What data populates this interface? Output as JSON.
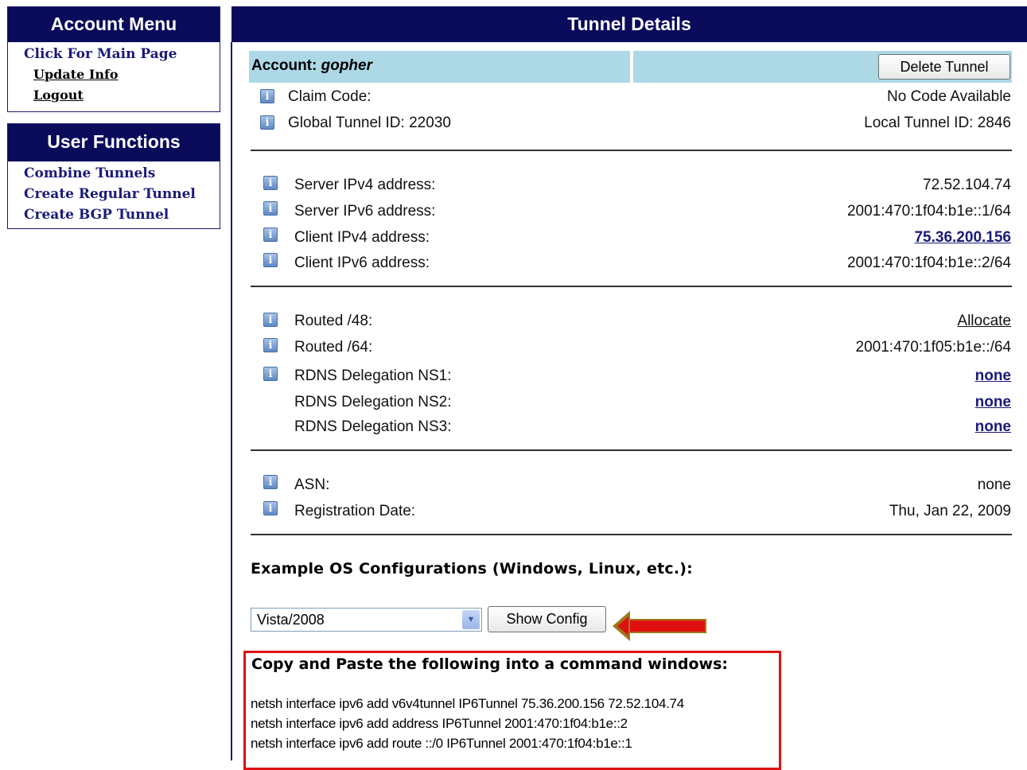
{
  "sidebar": {
    "account_menu": {
      "title": "Account Menu",
      "items": [
        "Click For Main Page",
        "Update Info",
        "Logout"
      ]
    },
    "user_functions": {
      "title": "User Functions",
      "items": [
        "Combine Tunnels",
        "Create Regular Tunnel",
        "Create BGP Tunnel"
      ]
    }
  },
  "main": {
    "title": "Tunnel Details",
    "account_label": "Account: ",
    "account_name": "gopher",
    "delete_button": "Delete Tunnel",
    "claim": {
      "label": "Claim Code:",
      "value": "No Code Available"
    },
    "ids": {
      "global": "Global Tunnel ID: 22030",
      "local": "Local Tunnel ID: 2846"
    },
    "addresses": [
      {
        "label": "Server IPv4 address:",
        "value": "72.52.104.74"
      },
      {
        "label": "Server IPv6 address:",
        "value": "2001:470:1f04:b1e::1/64"
      },
      {
        "label": "Client IPv4 address:",
        "value": "75.36.200.156"
      },
      {
        "label": "Client IPv6 address:",
        "value": "2001:470:1f04:b1e::2/64"
      }
    ],
    "routed": [
      {
        "label": "Routed /48:",
        "value": "Allocate"
      },
      {
        "label": "Routed /64:",
        "value": "2001:470:1f05:b1e::/64"
      },
      {
        "label": "RDNS Delegation NS1:",
        "value": "none"
      },
      {
        "label": "RDNS Delegation NS2:",
        "value": "none"
      },
      {
        "label": "RDNS Delegation NS3:",
        "value": "none"
      }
    ],
    "asn": {
      "label": "ASN:",
      "value": "none"
    },
    "registration": {
      "label": "Registration Date:",
      "value": "Thu, Jan 22, 2009"
    },
    "examples_heading": "Example OS Configurations (Windows, Linux, etc.):",
    "os_select": {
      "selected": "Vista/2008"
    },
    "show_config_button": "Show Config",
    "config": {
      "heading": "Copy and Paste the following into a command windows:",
      "lines": [
        "netsh interface ipv6 add v6v4tunnel IP6Tunnel 75.36.200.156 72.52.104.74",
        "netsh interface ipv6 add address IP6Tunnel 2001:470:1f04:b1e::2",
        "netsh interface ipv6 add route ::/0 IP6Tunnel 2001:470:1f04:b1e::1"
      ]
    }
  },
  "icons": {
    "info": "info-icon",
    "arrow": "left-arrow-icon",
    "dropdown": "chevron-down-icon"
  },
  "colors": {
    "header_bg": "#0b0b5c",
    "account_bar": "#add8e6",
    "highlight": "#e01010"
  }
}
